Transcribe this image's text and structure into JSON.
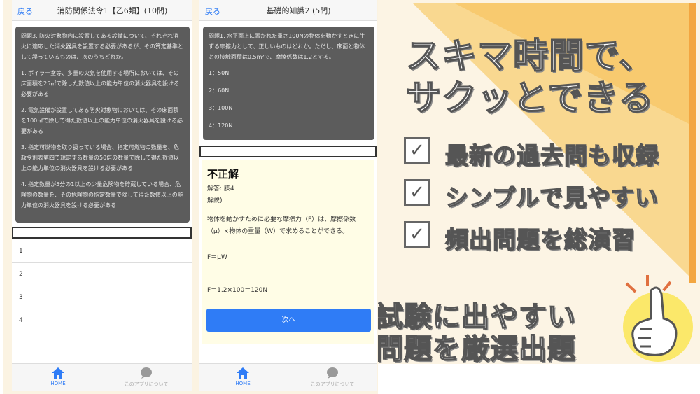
{
  "phone1": {
    "back": "戻る",
    "title": "消防関係法令1【乙6類】(10問)",
    "question": "問題3. 防火対象物内に設置してある設備について、それぞれ消火に適応した消火器具を設置する必要があるが、その算定基準として誤っているものは、次のうちどれか。",
    "choices": [
      "1. ボイラー室等、多量の火気を使用する場所においては、その床面積を25㎡で除した数値以上の能力単位の消火器具を設ける必要がある",
      "2. 電気設備が設置してある防火対象物においては、その床面積を100㎡で除して得た数値以上の能力単位の消火器具を設ける必要がある",
      "3. 指定可燃物を取り扱っている場合、指定可燃物の数量を、危政令別表第四で規定する数量の50倍の数量で除して得た数値以上の能力単位の消火器具を設ける必要がある",
      "4. 指定数量が5分の1以上の少量危険物を貯蔵している場合、危険物の数量を、その危険物の指定数量で除して得た数値以上の能力単位の消火器具を設ける必要がある"
    ],
    "options": [
      "1",
      "2",
      "3",
      "4"
    ]
  },
  "phone2": {
    "back": "戻る",
    "title": "基礎的知識2 (5問)",
    "question": "問題1. 水平面上に置かれた重さ100Nの物体を動かすときに生ずる摩擦力として、正しいものはどれか。ただし、床面と物体との接触面積は0.5m²で、摩擦係数は1.2とする。",
    "choices": [
      "1：50N",
      "2：60N",
      "3：100N",
      "4：120N"
    ],
    "verdict": "不正解",
    "answer": "解答: 肢4",
    "explain_label": "解説)",
    "explain": "物体を動かすために必要な摩擦力（F）は、摩擦係数（μ）×物体の重量（W）で求めることができる。",
    "formula1": "F＝μW",
    "formula2": "F＝1.2×100＝120N",
    "next": "次へ"
  },
  "tabs": {
    "home": "HOME",
    "about": "このアプリについて"
  },
  "banner": {
    "headline1": "スキマ時間で、",
    "headline2": "サクッとできる",
    "features": [
      "最新の過去問も収録",
      "シンプルで見やすい",
      "頻出問題を総演習"
    ],
    "bottom1": "試験に出やすい",
    "bottom2": "問題を厳選出題",
    "check": "✓"
  },
  "colors": {
    "accent": "#2f7cf6",
    "panel": "#5c5c5c",
    "result_bg": "#fffde6",
    "banner_bg": "#fcf4e4",
    "banner_orange": "#f6c25a"
  }
}
